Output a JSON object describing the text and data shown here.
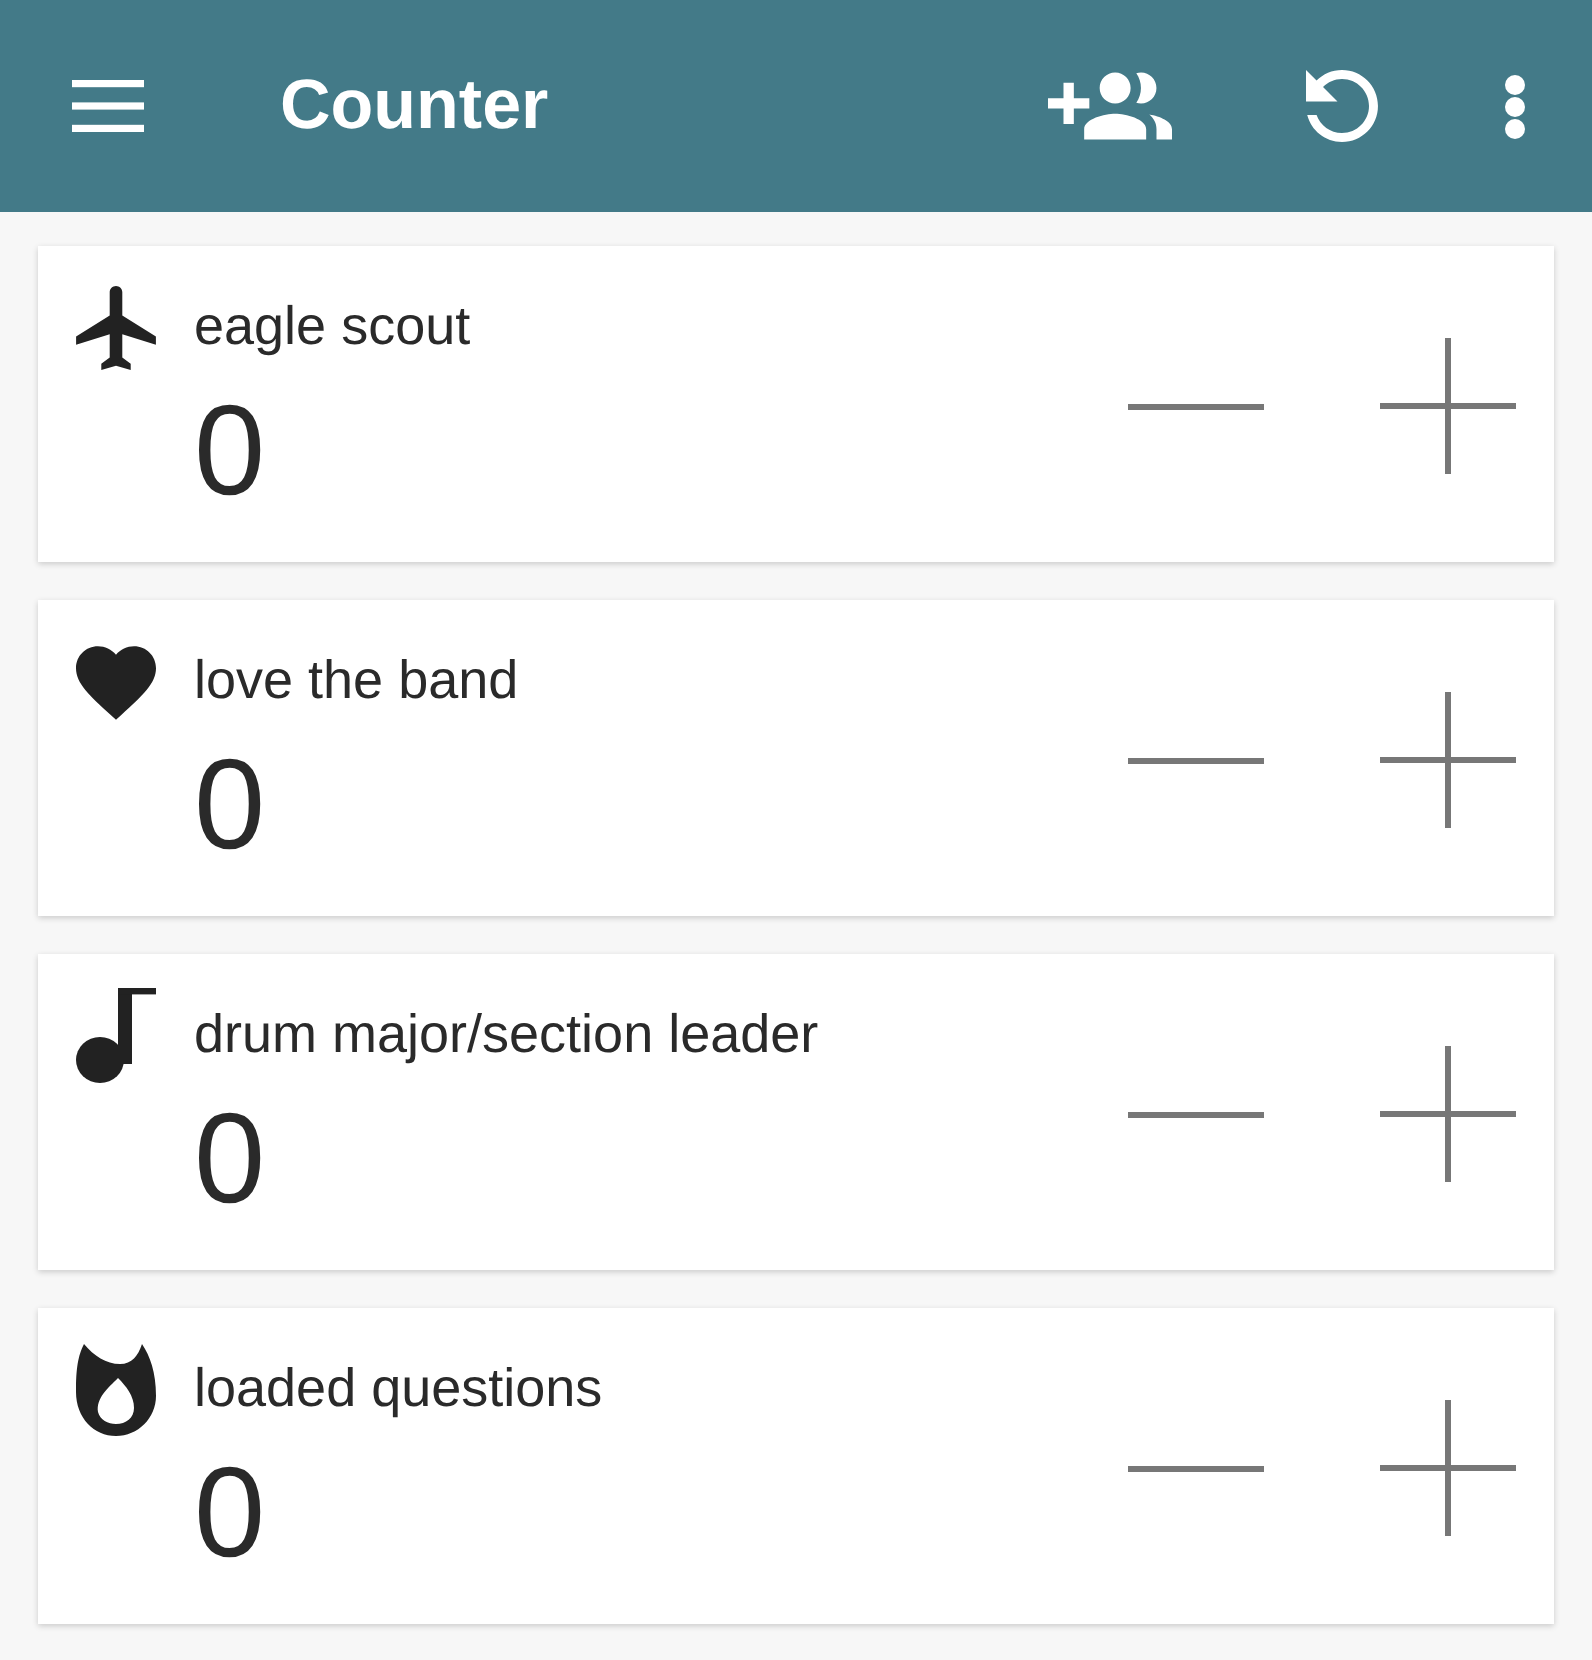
{
  "app_bar": {
    "title": "Counter"
  },
  "counters": [
    {
      "kind": "plane",
      "name": "eagle scout",
      "count": "0"
    },
    {
      "kind": "heart",
      "name": "love the band",
      "count": "0"
    },
    {
      "kind": "note",
      "name": "drum major/section leader",
      "count": "0"
    },
    {
      "kind": "flame",
      "name": "loaded questions",
      "count": "0"
    }
  ]
}
